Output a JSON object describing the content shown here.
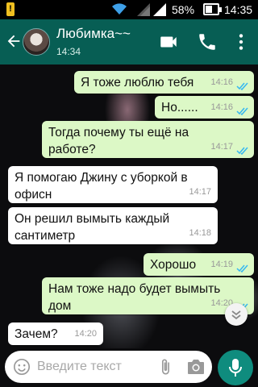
{
  "status_bar": {
    "battery": "58%",
    "battery_level": 0.58,
    "time": "14:35"
  },
  "header": {
    "contact_name": "Любимка~~",
    "last_seen": "14:34"
  },
  "messages": [
    {
      "direction": "out",
      "text": "Я тоже люблю тебя",
      "time": "14:16",
      "status": "read"
    },
    {
      "direction": "out",
      "text": "Но......",
      "time": "14:16",
      "status": "read"
    },
    {
      "direction": "out",
      "text": "Тогда почему ты ещё на работе?",
      "time": "14:17",
      "status": "read"
    },
    {
      "direction": "in",
      "text": "Я помогаю Джину с уборкой в офисн",
      "time": "14:17"
    },
    {
      "direction": "in",
      "text": "Он решил вымыть каждый сантиметр",
      "time": "14:18"
    },
    {
      "direction": "out",
      "text": "Хорошо",
      "time": "14:19",
      "status": "read"
    },
    {
      "direction": "out",
      "text": "Нам тоже надо будет вымыть дом",
      "time": "14:20",
      "status": "read"
    },
    {
      "direction": "in",
      "text": "Зачем?",
      "time": "14:20"
    }
  ],
  "input": {
    "placeholder": "Введите текст"
  },
  "colors": {
    "header": "#075e54",
    "outgoing_bubble": "#dcf8c6",
    "incoming_bubble": "#ffffff",
    "read_ticks": "#34b7f1",
    "mic_button": "#0f8c7e"
  },
  "icons": [
    "back-arrow-icon",
    "video-call-icon",
    "phone-icon",
    "more-vert-icon",
    "emoji-icon",
    "attach-icon",
    "camera-icon",
    "mic-icon",
    "chevron-down-icon"
  ]
}
